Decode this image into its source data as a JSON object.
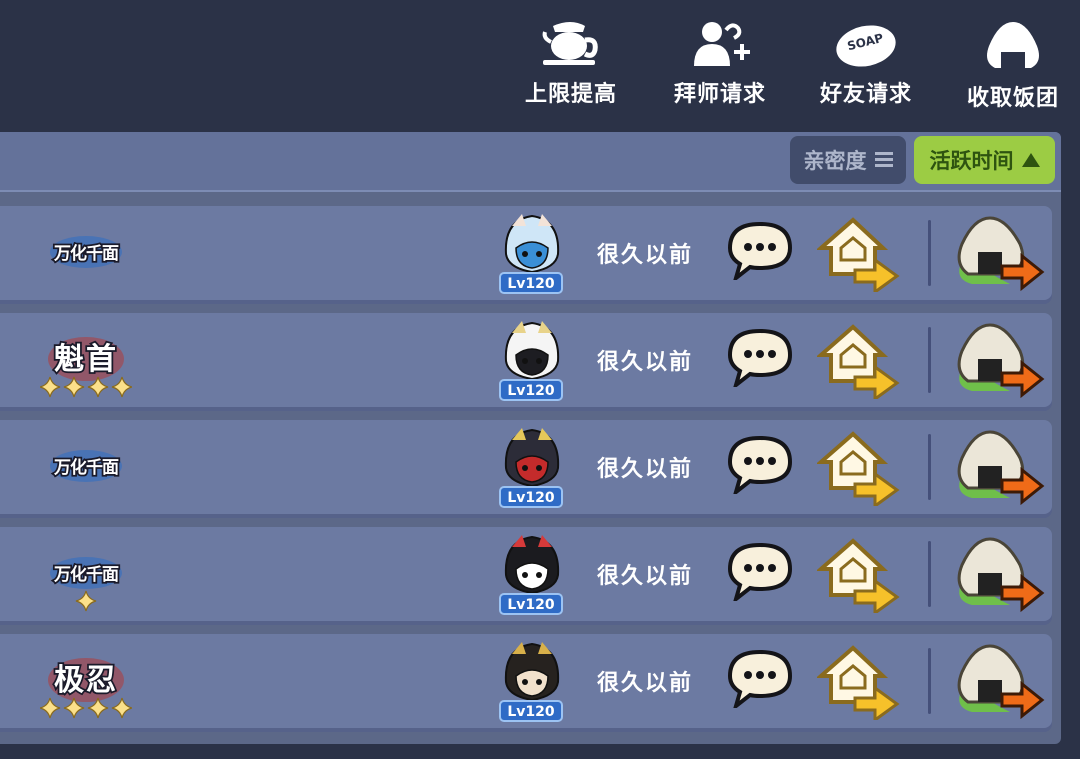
{
  "top_actions": [
    {
      "label": "上限提高",
      "icon": "teapot-icon"
    },
    {
      "label": "拜师请求",
      "icon": "apprentice-request-icon"
    },
    {
      "label": "好友请求",
      "icon": "soap-friend-request-icon"
    },
    {
      "label": "收取饭团",
      "icon": "rice-ball-icon"
    }
  ],
  "soap_text": "SOAP",
  "sort": {
    "affinity_label": "亲密度",
    "activity_label": "活跃时间"
  },
  "rows": [
    {
      "badge": "万化千面",
      "stars": 0,
      "level": "Lv120",
      "last_active": "很久以前",
      "avatar": "white-hair-girl-avatar"
    },
    {
      "badge": "魁首",
      "stars": 4,
      "level": "Lv120",
      "last_active": "很久以前",
      "avatar": "captain-hat-avatar"
    },
    {
      "badge": "万化千面",
      "stars": 0,
      "level": "Lv120",
      "last_active": "很久以前",
      "avatar": "samurai-helmet-avatar"
    },
    {
      "badge": "万化千面",
      "stars": 1,
      "level": "Lv120",
      "last_active": "很久以前",
      "avatar": "fox-mask-avatar"
    },
    {
      "badge": "极忍",
      "stars": 4,
      "level": "Lv120",
      "last_active": "很久以前",
      "avatar": "bun-hair-girl-avatar"
    }
  ],
  "colors": {
    "panel": "#5c6888",
    "row": "#6c7aa2",
    "activity_sort": "#9ccc44",
    "level_badge": "#2f6bc6",
    "home_arrow": "#f6c12a",
    "rice_arrow": "#ef6b18"
  }
}
